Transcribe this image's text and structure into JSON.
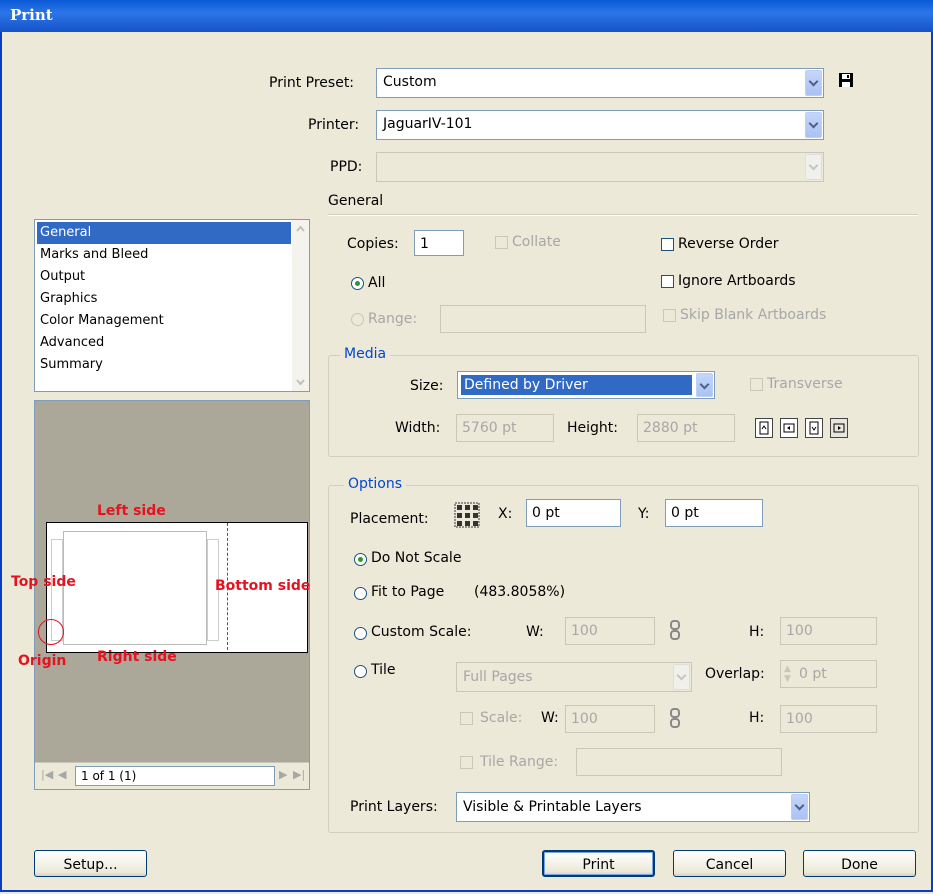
{
  "window": {
    "title": "Print"
  },
  "preset": {
    "label": "Print Preset:",
    "value": "Custom"
  },
  "printer": {
    "label": "Printer:",
    "value": "JaguarIV-101"
  },
  "ppd": {
    "label": "PPD:",
    "value": ""
  },
  "section_title": "General",
  "sidebar": {
    "items": [
      {
        "label": "General",
        "selected": true
      },
      {
        "label": "Marks and Bleed"
      },
      {
        "label": "Output"
      },
      {
        "label": "Graphics"
      },
      {
        "label": "Color Management"
      },
      {
        "label": "Advanced"
      },
      {
        "label": "Summary"
      }
    ]
  },
  "preview": {
    "annotations": {
      "left": "Left side",
      "top": "Top side",
      "bottom": "Bottom side",
      "right": "Right side",
      "origin": "Origin"
    },
    "page_field": "1 of 1 (1)",
    "annotation_color": "#e4131f"
  },
  "general": {
    "copies_label": "Copies:",
    "copies_value": "1",
    "collate": "Collate",
    "reverse_order": "Reverse Order",
    "all": "All",
    "ignore_artboards": "Ignore Artboards",
    "range": "Range:",
    "skip_blank": "Skip Blank Artboards"
  },
  "media": {
    "title": "Media",
    "size_label": "Size:",
    "size_value": "Defined by Driver",
    "transverse": "Transverse",
    "width_label": "Width:",
    "width_value": "5760 pt",
    "height_label": "Height:",
    "height_value": "2880 pt",
    "orientation_icons": [
      "portrait-icon",
      "landscape-icon",
      "portrait-flipped-icon",
      "landscape-flipped-icon"
    ]
  },
  "options": {
    "title": "Options",
    "placement_label": "Placement:",
    "x_label": "X:",
    "x_value": "0 pt",
    "y_label": "Y:",
    "y_value": "0 pt",
    "do_not_scale": "Do Not Scale",
    "fit_to_page": "Fit to Page",
    "fit_percent": "(483.8058%)",
    "custom_scale": "Custom Scale:",
    "w_label": "W:",
    "w_value": "100",
    "h_label": "H:",
    "h_value": "100",
    "tile": "Tile",
    "tile_value": "Full Pages",
    "overlap_label": "Overlap:",
    "overlap_value": "0 pt",
    "scale": "Scale:",
    "scale_w_label": "W:",
    "scale_w_value": "100",
    "scale_h_label": "H:",
    "scale_h_value": "100",
    "tile_range": "Tile Range:",
    "print_layers_label": "Print Layers:",
    "print_layers_value": "Visible & Printable Layers"
  },
  "buttons": {
    "setup": "Setup...",
    "print": "Print",
    "cancel": "Cancel",
    "done": "Done"
  }
}
